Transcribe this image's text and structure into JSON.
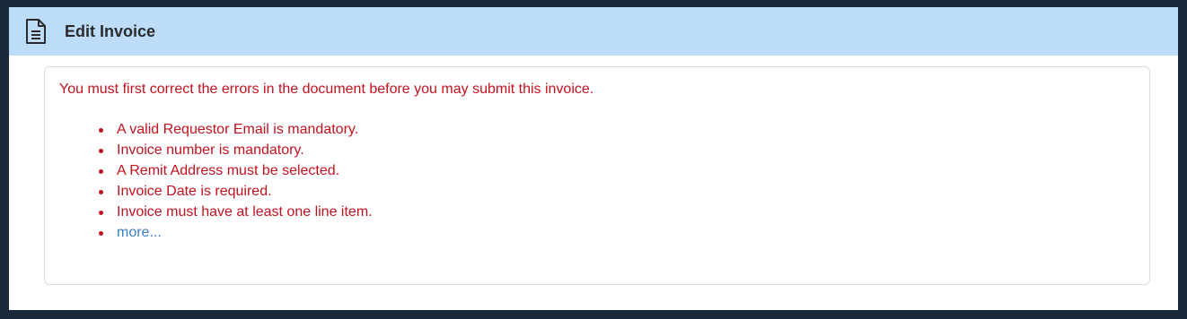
{
  "header": {
    "title": "Edit Invoice",
    "icon": "document-icon"
  },
  "errors": {
    "intro": "You must first correct the errors in the document before you may submit this invoice.",
    "items": [
      "A valid Requestor Email is mandatory.",
      "Invoice number is mandatory.",
      "A Remit Address must be selected.",
      "Invoice Date is required.",
      "Invoice must have at least one line item."
    ],
    "more_label": "more..."
  },
  "colors": {
    "header_bg": "#bcdcfa",
    "error_text": "#c1121f",
    "link": "#3b7fc4",
    "outer_border": "#1b2a3a"
  }
}
